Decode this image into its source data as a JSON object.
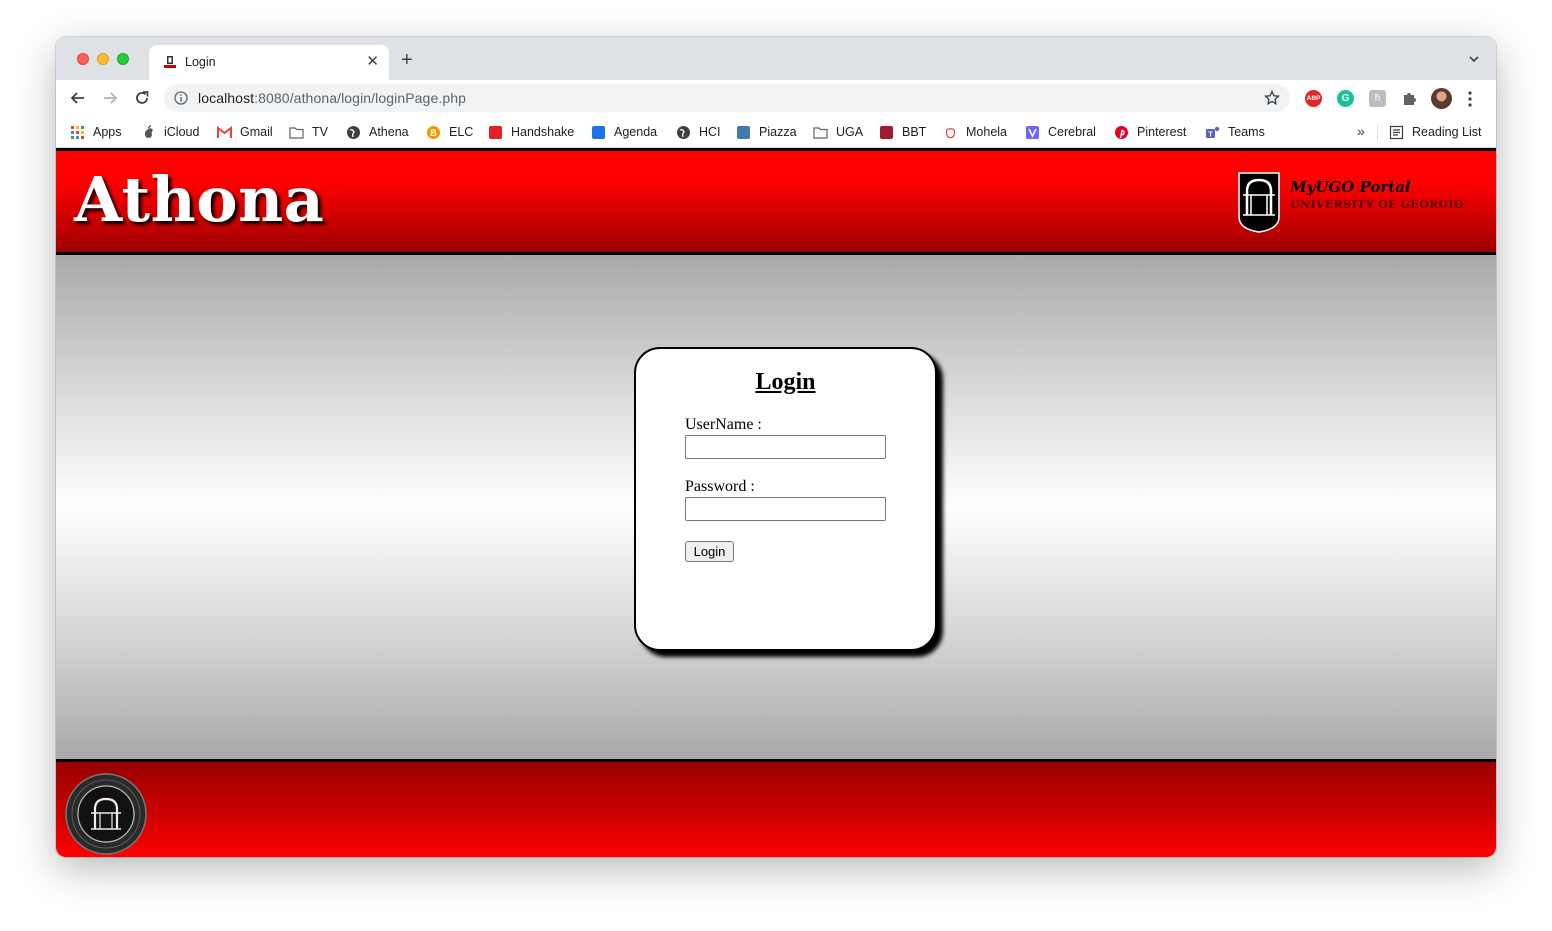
{
  "browser": {
    "tab_title": "Login",
    "url_host": "localhost",
    "url_rest": ":8080/athona/login/loginPage.php",
    "bookmarks": [
      {
        "label": "Apps",
        "icon": "apps-grid-icon",
        "color": "#4285f4"
      },
      {
        "label": "iCloud",
        "icon": "apple-icon",
        "color": "#555555"
      },
      {
        "label": "Gmail",
        "icon": "gmail-icon",
        "color": "#ea4335"
      },
      {
        "label": "TV",
        "icon": "folder-icon",
        "color": "#5f6368"
      },
      {
        "label": "Athena",
        "icon": "globe-icon",
        "color": "#3c4043"
      },
      {
        "label": "ELC",
        "icon": "elc-icon",
        "color": "#f29900"
      },
      {
        "label": "Handshake",
        "icon": "handshake-icon",
        "color": "#e0202a"
      },
      {
        "label": "Agenda",
        "icon": "agenda-icon",
        "color": "#1a73e8"
      },
      {
        "label": "HCI",
        "icon": "globe-icon",
        "color": "#3c4043"
      },
      {
        "label": "Piazza",
        "icon": "piazza-icon",
        "color": "#3e7aab"
      },
      {
        "label": "UGA",
        "icon": "folder-icon",
        "color": "#5f6368"
      },
      {
        "label": "BBT",
        "icon": "bbt-icon",
        "color": "#9e1b32"
      },
      {
        "label": "Mohela",
        "icon": "mohela-icon",
        "color": "#e53935"
      },
      {
        "label": "Cerebral",
        "icon": "cerebral-icon",
        "color": "#6c63ff"
      },
      {
        "label": "Pinterest",
        "icon": "pinterest-icon",
        "color": "#e60023"
      },
      {
        "label": "Teams",
        "icon": "teams-icon",
        "color": "#5b5fc7"
      }
    ],
    "more": "»",
    "reading_list": "Reading List",
    "ext_abp": "ABP",
    "ext_g": "G",
    "ext_h": "ħ"
  },
  "header": {
    "site_title": "Athona",
    "portal_title": "MyUGO Portal",
    "portal_subtitle": "UNIVERSITY OF GEORGIO"
  },
  "login": {
    "heading": "Login",
    "username_label": "UserName :",
    "username_value": "",
    "password_label": "Password :",
    "password_value": "",
    "submit_label": "Login"
  },
  "colors": {
    "brand_red": "#ff0000",
    "dark_red": "#990000"
  }
}
